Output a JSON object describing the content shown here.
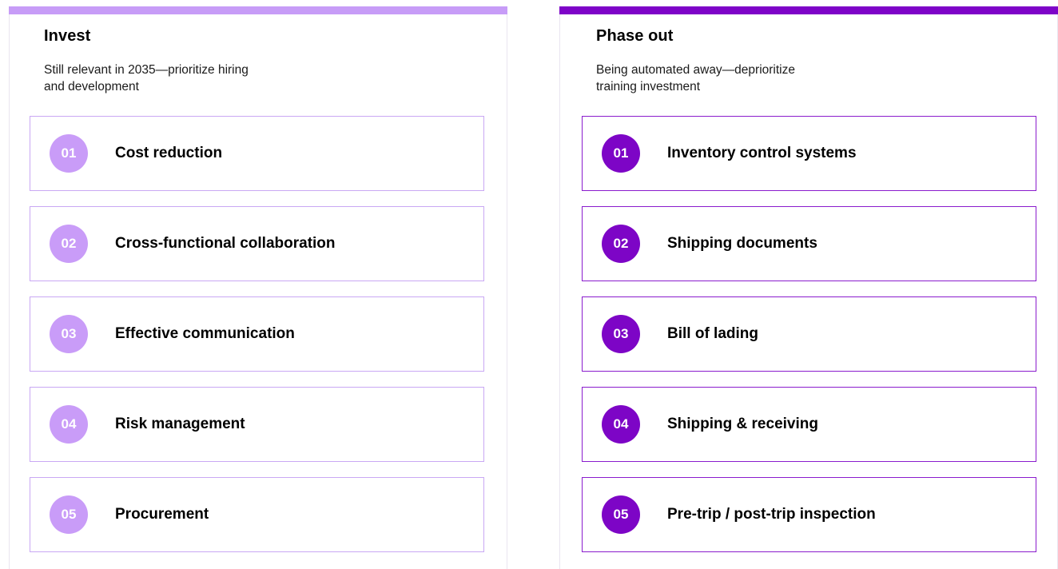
{
  "colors": {
    "invest_accent": "#c79cf7",
    "invest_border": "#c9a8f4",
    "invest_badge": "#c99cf8",
    "phase_out_accent": "#7e04c8",
    "phase_out_border": "#8a1ccd",
    "phase_out_badge": "#7d05c6"
  },
  "invest": {
    "title": "Invest",
    "subtitle_line1": "Still relevant in 2035—prioritize hiring",
    "subtitle_line2": "and development",
    "items": [
      {
        "number": "01",
        "label": "Cost reduction"
      },
      {
        "number": "02",
        "label": "Cross-functional collaboration"
      },
      {
        "number": "03",
        "label": "Effective communication"
      },
      {
        "number": "04",
        "label": "Risk management"
      },
      {
        "number": "05",
        "label": "Procurement"
      }
    ]
  },
  "phase_out": {
    "title": "Phase out",
    "subtitle_line1": "Being automated away—deprioritize",
    "subtitle_line2": "training investment",
    "items": [
      {
        "number": "01",
        "label": "Inventory control systems"
      },
      {
        "number": "02",
        "label": "Shipping documents"
      },
      {
        "number": "03",
        "label": "Bill of lading"
      },
      {
        "number": "04",
        "label": "Shipping & receiving"
      },
      {
        "number": "05",
        "label": "Pre-trip / post-trip inspection"
      }
    ]
  }
}
